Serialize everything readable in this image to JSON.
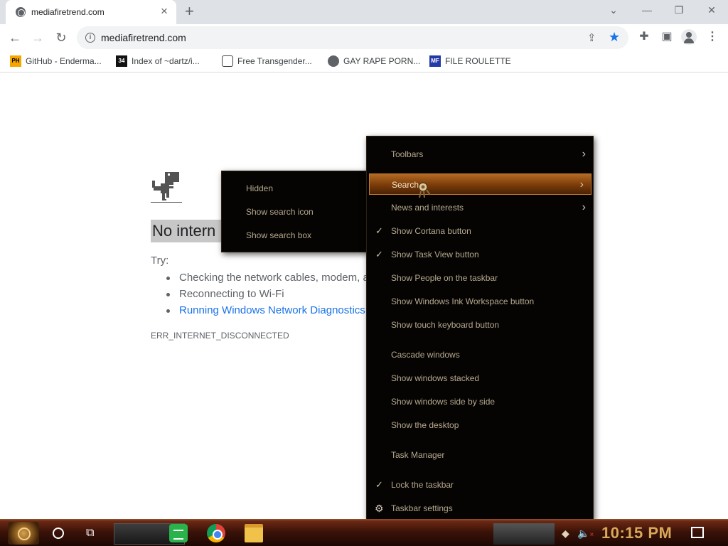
{
  "browser": {
    "tab_title": "mediafiretrend.com",
    "tab_close": "×",
    "new_tab": "+",
    "window_controls": {
      "dropdown": "⌄",
      "minimize": "—",
      "restore": "❐",
      "close": "✕"
    },
    "url": "mediafiretrend.com",
    "nav": {
      "back": "←",
      "forward": "→",
      "reload": "↻"
    },
    "toolbar_icons": [
      "share-icon",
      "bookmark-star-icon",
      "extensions-icon",
      "side-panel-icon",
      "profile-icon",
      "menu-icon"
    ],
    "star_color": "#1a73e8"
  },
  "bookmarks": [
    {
      "label": "GitHub - Enderma...",
      "icon": "ph-icon",
      "badge": "PH"
    },
    {
      "label": "Index of ~dartz/i...",
      "icon": "index-icon",
      "badge": "34"
    },
    {
      "label": "Free Transgender...",
      "icon": "site-icon",
      "badge": ""
    },
    {
      "label": "GAY RAPE PORN...",
      "icon": "globe-icon",
      "badge": ""
    },
    {
      "label": "FILE ROULETTE",
      "icon": "mf-icon",
      "badge": "MF"
    }
  ],
  "page": {
    "title": "No intern",
    "try_label": "Try:",
    "suggestions": [
      "Checking the network cables, modem, a",
      "Reconnecting to Wi-Fi",
      "Running Windows Network Diagnostics"
    ],
    "error_code": "ERR_INTERNET_DISCONNECTED"
  },
  "submenu": {
    "items": [
      "Hidden",
      "Show search icon",
      "Show search box"
    ]
  },
  "context_menu": {
    "items": [
      {
        "label": "Toolbars",
        "checked": false,
        "arrow": true
      },
      {
        "label": "Search",
        "checked": false,
        "arrow": true,
        "highlighted": true
      },
      {
        "label": "News and interests",
        "checked": false,
        "arrow": true
      },
      {
        "label": "Show Cortana button",
        "checked": true
      },
      {
        "label": "Show Task View button",
        "checked": true
      },
      {
        "label": "Show People on the taskbar",
        "checked": false
      },
      {
        "label": "Show Windows Ink Workspace button",
        "checked": false
      },
      {
        "label": "Show touch keyboard button",
        "checked": false
      },
      {
        "label": "Cascade windows",
        "checked": false
      },
      {
        "label": "Show windows stacked",
        "checked": false
      },
      {
        "label": "Show windows side by side",
        "checked": false
      },
      {
        "label": "Show the desktop",
        "checked": false
      },
      {
        "label": "Task Manager",
        "checked": false
      },
      {
        "label": "Lock the taskbar",
        "checked": true
      },
      {
        "label": "Taskbar settings",
        "checked": false,
        "icon": "gear-icon"
      }
    ],
    "check_glyph": "✓",
    "arrow_glyph": "›",
    "gear_glyph": "⚙",
    "highlight_color": "#9a5216"
  },
  "taskbar": {
    "clock": "10:15 PM",
    "volume_icon": "🔈",
    "volume_muted_mark": "×",
    "pinned": [
      "spotify-icon",
      "chrome-icon",
      "file-explorer-icon"
    ],
    "clock_color": "#d9a85a"
  }
}
